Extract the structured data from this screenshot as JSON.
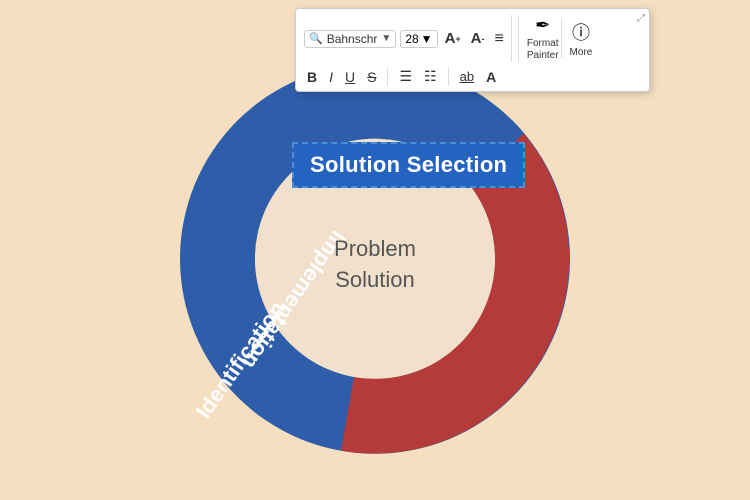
{
  "toolbar": {
    "font_name": "Bahnschr",
    "font_size": "28",
    "collapse_icon": "⤢",
    "increase_font_icon": "A↑",
    "decrease_font_icon": "A↓",
    "align_icon": "≡",
    "bold_label": "B",
    "italic_label": "I",
    "underline_label": "U",
    "strikethrough_label": "S",
    "bullets_label": "☰",
    "list_label": "☷",
    "underline2_label": "ab",
    "caps_label": "A",
    "format_painter_label": "Format\nPainter",
    "format_painter_icon": "✏",
    "more_label": "More",
    "more_icon": "ⓘ"
  },
  "diagram": {
    "solution_selection_text": "Solution Selection",
    "center_line1": "Problem",
    "center_line2": "Solution",
    "identification_label": "Identification",
    "implementation_label": "Implementation"
  },
  "colors": {
    "blue": "#2E5EAA",
    "red": "#B53A3A",
    "bg": "#f5dfc0",
    "center_bg": "#f0e0cc",
    "white": "#ffffff",
    "selection_blue": "#2563c0"
  }
}
